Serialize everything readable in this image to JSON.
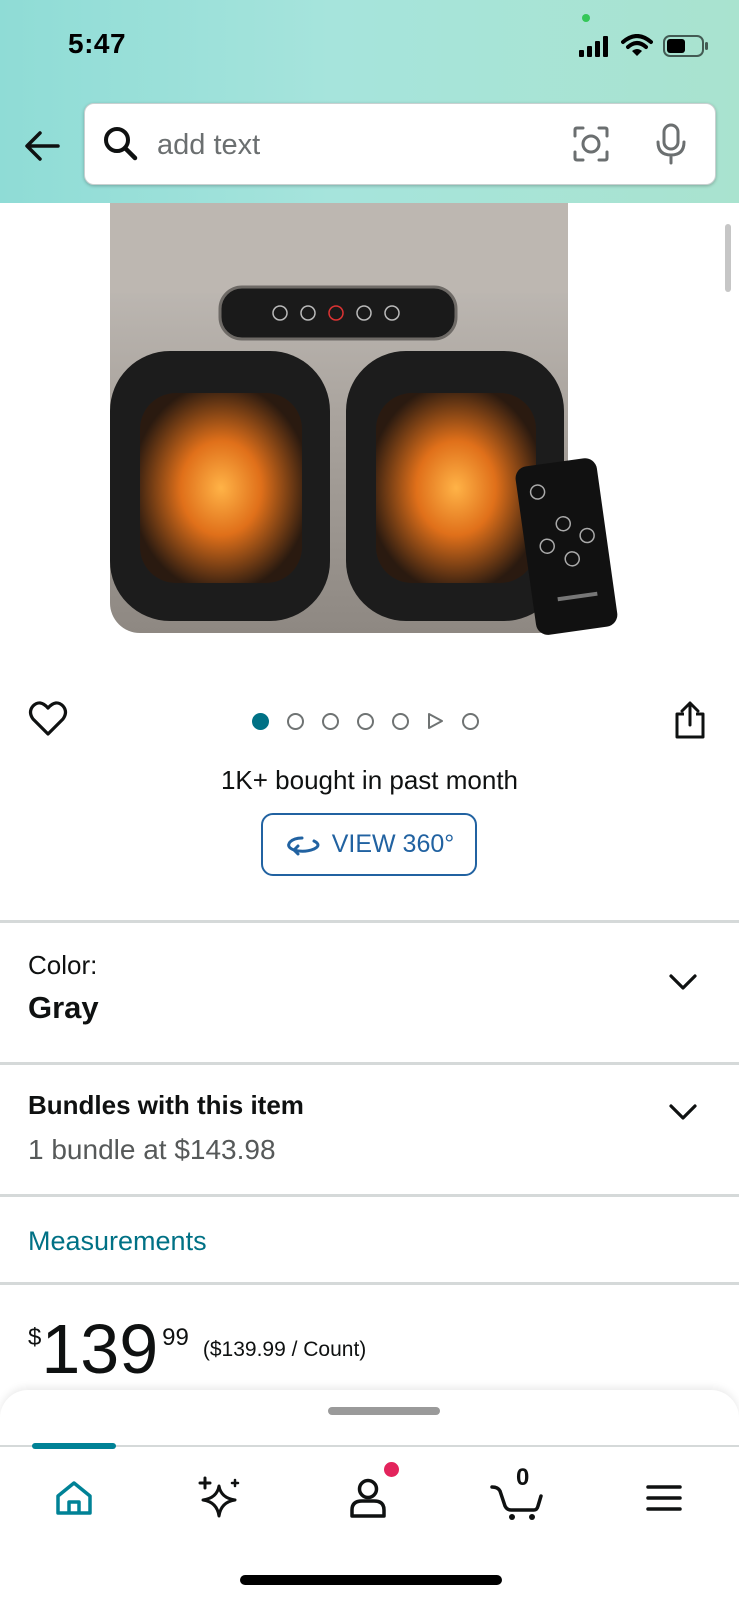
{
  "status_bar": {
    "time": "5:47"
  },
  "search": {
    "placeholder": "add text"
  },
  "product": {
    "image_alt": "Gray shiatsu foot massager with remote control",
    "image_count_dots": 7,
    "bought_text": "1K+ bought in past month",
    "view360_label": "VIEW 360°"
  },
  "color": {
    "label": "Color:",
    "value": "Gray"
  },
  "bundles": {
    "title": "Bundles with this item",
    "subtitle": "1 bundle at $143.98"
  },
  "measurements": {
    "label": "Measurements"
  },
  "price": {
    "symbol": "$",
    "whole": "139",
    "fraction": "99",
    "per_unit": "($139.99 / Count)"
  },
  "cart": {
    "count": "0"
  },
  "tabs": [
    {
      "name": "home",
      "active": true
    },
    {
      "name": "rufus"
    },
    {
      "name": "account",
      "has_notification": true
    },
    {
      "name": "cart"
    },
    {
      "name": "menu"
    }
  ],
  "colors": {
    "accent_teal": "#007185",
    "link_blue": "#2162a1",
    "notification": "#e3245c"
  }
}
